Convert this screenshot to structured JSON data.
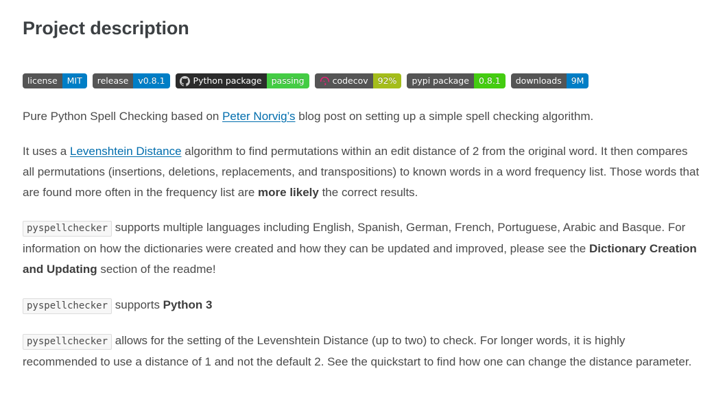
{
  "header": {
    "title": "Project description"
  },
  "badges": [
    {
      "name": "license-badge",
      "label": "license",
      "value": "MIT",
      "label_color": "#555555",
      "value_color": "#007ec6",
      "icon": null
    },
    {
      "name": "release-badge",
      "label": "release",
      "value": "v0.8.1",
      "label_color": "#555555",
      "value_color": "#007ec6",
      "icon": null
    },
    {
      "name": "python-package-build-badge",
      "label": "Python package",
      "value": "passing",
      "label_color": "#2b2b2b",
      "value_color": "#44cc44",
      "icon": "github-icon"
    },
    {
      "name": "codecov-badge",
      "label": "codecov",
      "value": "92%",
      "label_color": "#555555",
      "value_color": "#a4bd1b",
      "icon": "codecov-icon"
    },
    {
      "name": "pypi-package-badge",
      "label": "pypi package",
      "value": "0.8.1",
      "label_color": "#555555",
      "value_color": "#44cc11",
      "icon": null
    },
    {
      "name": "downloads-badge",
      "label": "downloads",
      "value": "9M",
      "label_color": "#555555",
      "value_color": "#007ec6",
      "icon": null
    }
  ],
  "paragraphs": {
    "p1": {
      "a": "Pure Python Spell Checking based on ",
      "link": "Peter Norvig’s",
      "b": " blog post on setting up a simple spell checking algorithm."
    },
    "p2": {
      "a": "It uses a ",
      "link": "Levenshtein Distance",
      "b": " algorithm to find permutations within an edit distance of 2 from the original word. It then compares all permutations (insertions, deletions, replacements, and transpositions) to known words in a word frequency list. Those words that are found more often in the frequency list are ",
      "bold": "more likely",
      "c": " the correct results."
    },
    "p3": {
      "code": "pyspellchecker",
      "a": " supports multiple languages including English, Spanish, German, French, Portuguese, Arabic and Basque. For information on how the dictionaries were created and how they can be updated and improved, please see the ",
      "bold": "Dictionary Creation and Updating",
      "b": " section of the readme!"
    },
    "p4": {
      "code": "pyspellchecker",
      "a": " supports ",
      "bold": "Python 3"
    },
    "p5": {
      "code": "pyspellchecker",
      "a": " allows for the setting of the Levenshtein Distance (up to two) to check. For longer words, it is highly recommended to use a distance of 1 and not the default 2. See the quickstart to find how one can change the distance parameter."
    }
  }
}
